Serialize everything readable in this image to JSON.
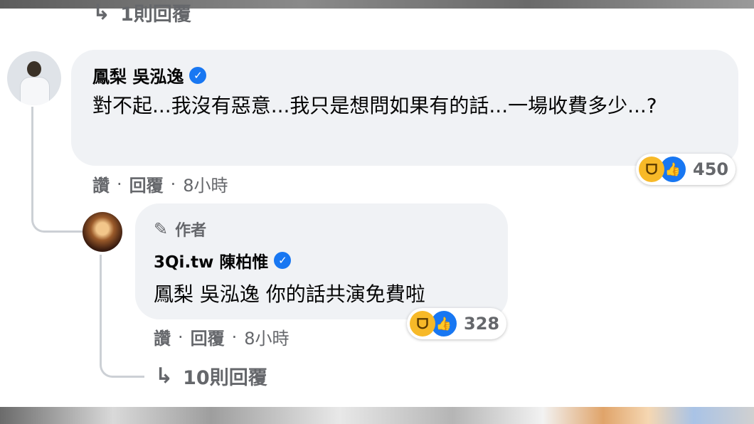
{
  "top_reply_link": {
    "icon": "reply-arrow-icon",
    "label": "1則回覆"
  },
  "comment1": {
    "author_name": "鳳梨 吳泓逸",
    "verified_icon": "verified-badge-icon",
    "text": "對不起...我沒有惡意...我只是想問如果有的話...一場收費多少...?",
    "reactions": {
      "icons": [
        "haha-icon",
        "like-icon"
      ],
      "count": "450"
    },
    "actions": {
      "like": "讚",
      "separator": "·",
      "reply": "回覆",
      "time": "8小時"
    }
  },
  "reply1": {
    "author_badge": {
      "icon": "pencil-icon",
      "label": "作者"
    },
    "author_name": "3Qi.tw 陳柏惟",
    "verified_icon": "verified-badge-icon",
    "text": "鳳梨 吳泓逸 你的話共演免費啦",
    "reactions": {
      "icons": [
        "haha-icon",
        "like-icon"
      ],
      "count": "328"
    },
    "actions": {
      "like": "讚",
      "separator": "·",
      "reply": "回覆",
      "time": "8小時"
    }
  },
  "bottom_reply_link": {
    "icon": "reply-arrow-icon",
    "label": "10則回覆"
  },
  "colors": {
    "bubble": "#f0f2f5",
    "verified": "#1877f2",
    "muted_text": "#65676b",
    "haha": "#f7b928"
  }
}
